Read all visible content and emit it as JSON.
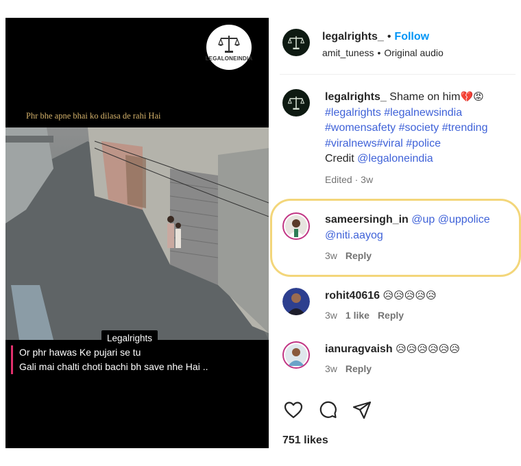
{
  "video": {
    "logo_text": "LEGALONEINDIA",
    "top_caption": "Phr bhe apne bhai ko dilasa de rahi Hai",
    "channel_badge": "Legalrights",
    "subtitle_line1": "Or phr hawas Ke pujari se tu",
    "subtitle_line2": "Gali mai chalti choti bachi bh save nhe Hai .."
  },
  "header": {
    "username": "legalrights_",
    "follow_label": "Follow",
    "audio_user": "amit_tuness",
    "audio_label": "Original audio"
  },
  "caption": {
    "username": "legalrights_",
    "text": "Shame on him",
    "emojis": "💔😡",
    "hashtags_line1": "#legalrights #legalnewsindia",
    "hashtags_line2": "#womensafety #society #trending",
    "hashtags_line3": "#viralnews#viral #police",
    "credit_label": "Credit",
    "credit_handle": "@legaloneindia",
    "edited": "Edited",
    "time": "3w"
  },
  "comments": [
    {
      "username": "sameersingh_in",
      "mentions_line1": "@up @uppolice",
      "mentions_line2": "@niti.aayog",
      "time": "3w",
      "reply_label": "Reply"
    },
    {
      "username": "rohit40616",
      "emojis": "😥😥😥😥😥",
      "time": "3w",
      "likes": "1 like",
      "reply_label": "Reply"
    },
    {
      "username": "ianuragvaish",
      "emojis": "😥😥😥😥😥😥",
      "time": "3w",
      "reply_label": "Reply"
    }
  ],
  "footer": {
    "likes": "751 likes"
  },
  "icons": [
    "scale-logo-icon",
    "heart-icon",
    "comment-icon",
    "share-icon"
  ],
  "colors": {
    "link": "#3f62d8",
    "follow": "#0095f6",
    "highlight": "#f3d67a",
    "subtitle_bar": "#e1306c"
  }
}
